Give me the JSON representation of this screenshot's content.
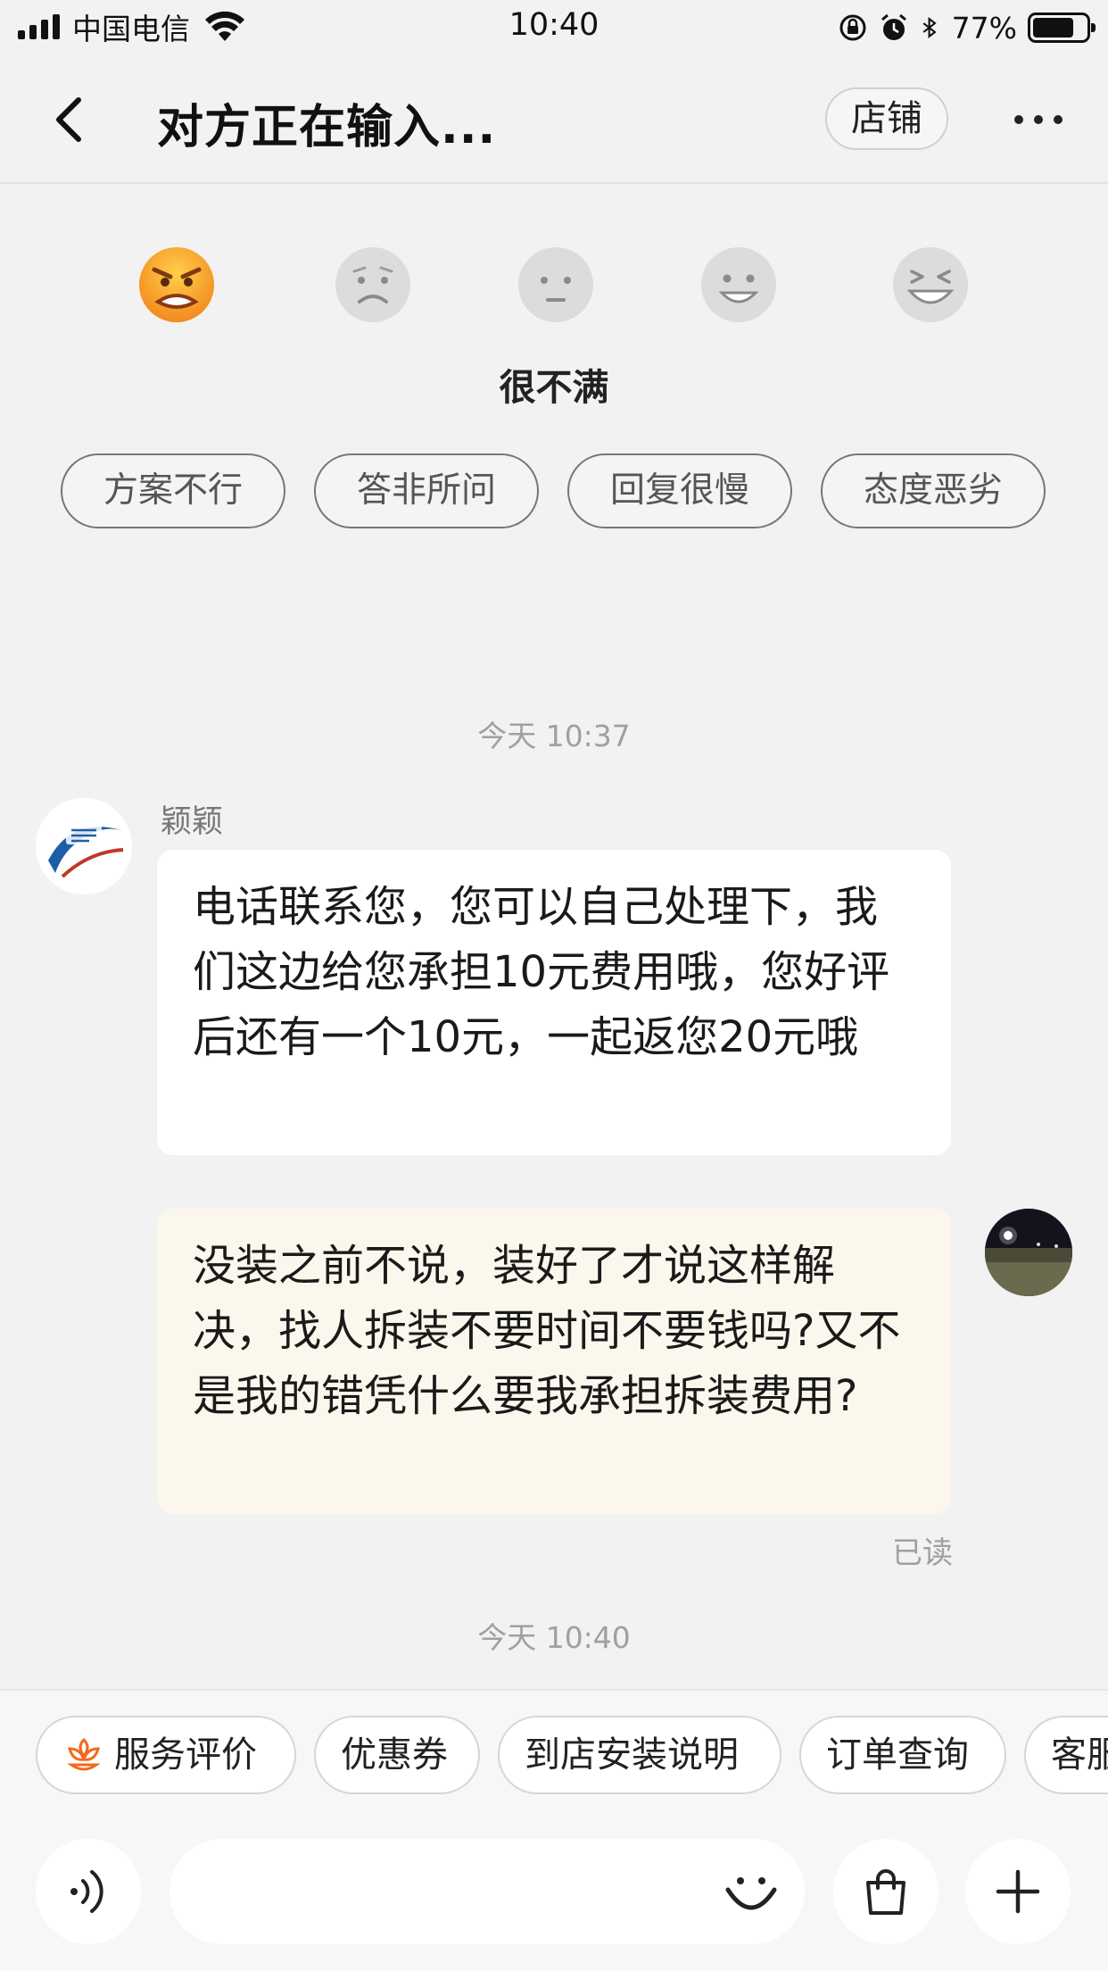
{
  "status_bar": {
    "carrier": "中国电信",
    "time": "10:40",
    "battery_percent": "77%",
    "battery_level": 0.77,
    "icons": [
      "signal-icon",
      "wifi-icon",
      "orientation-lock-icon",
      "alarm-icon",
      "bluetooth-icon",
      "battery-icon"
    ]
  },
  "header": {
    "title": "对方正在输入...",
    "shop_label": "店铺",
    "back_icon": "chevron-left-icon",
    "more_icon": "more-dots-icon"
  },
  "rating": {
    "faces": [
      "very-angry-face-icon",
      "sad-face-icon",
      "neutral-face-icon",
      "smile-face-icon",
      "laughing-face-icon"
    ],
    "selected_index": 0,
    "selected_label": "很不满",
    "tags": [
      "方案不行",
      "答非所问",
      "回复很慢",
      "态度恶劣"
    ]
  },
  "chat": {
    "timestamp_1": "今天 10:37",
    "agent_name": "颖颖",
    "agent_message": "电话联系您，您可以自己处理下，我们这边给您承担10元费用哦，您好评后还有一个10元，一起返您20元哦",
    "user_message": "没装之前不说，装好了才说这样解决，找人拆装不要时间不要钱吗?又不是我的错凭什么要我承担拆装费用?",
    "read_status": "已读",
    "timestamp_2": "今天 10:40"
  },
  "quick_actions": {
    "items": [
      "服务评价",
      "优惠券",
      "到店安装说明",
      "订单查询",
      "客服"
    ]
  },
  "input": {
    "placeholder": "",
    "value": "",
    "icons": [
      "voice-icon",
      "emoji-icon",
      "shopping-bag-icon",
      "plus-icon"
    ]
  },
  "colors": {
    "background": "#f2f2f2",
    "user_bubble": "#fbf7ec",
    "agent_bubble": "#ffffff",
    "accent_orange": "#f06a1d"
  }
}
